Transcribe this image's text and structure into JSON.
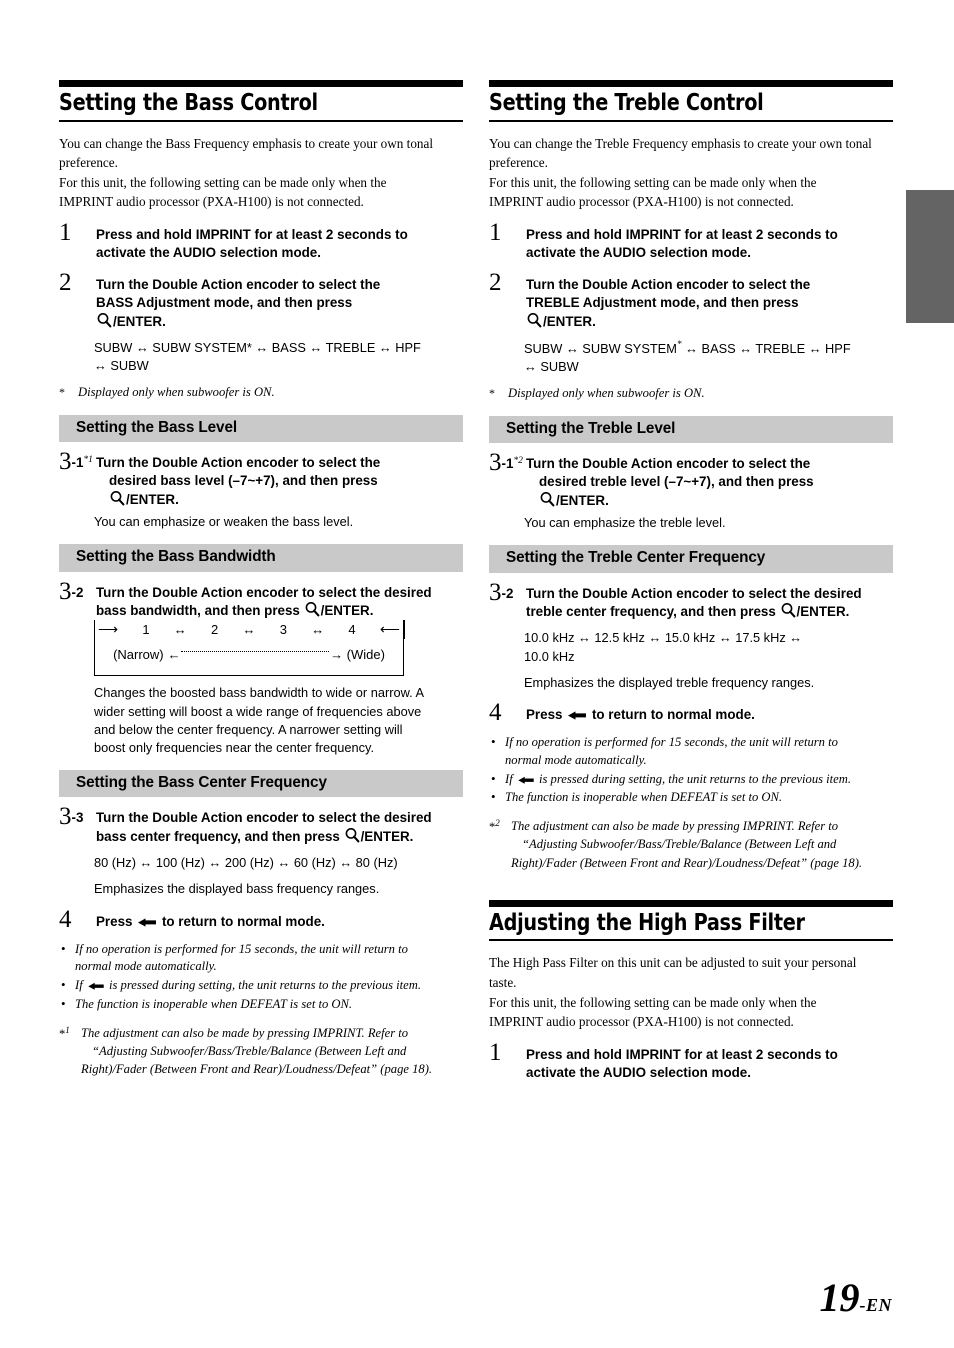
{
  "page": {
    "number": "19",
    "suffix": "-EN",
    "tab_marker_color": "#646464",
    "bar_color": "#c9c9c9"
  },
  "left_column": {
    "title": "Setting the Bass Control",
    "intro": [
      "You can change the Bass Frequency emphasis to create your own tonal",
      "preference.",
      "For this unit, the following setting can be made only when the",
      "IMPRINT audio processor (PXA-H100) is not connected."
    ],
    "step1": {
      "num": "1",
      "line1_a": "Press and hold ",
      "line1_b": "IMPRINT",
      "line1_c": " for at least 2 seconds to",
      "line2": "activate the AUDIO selection mode."
    },
    "step2": {
      "num": "2",
      "line1_a": "Turn the ",
      "line1_b": "Double Action encoder",
      "line1_c": " to select the",
      "line2": "BASS Adjustment mode, and then press",
      "line3": "/ENTER."
    },
    "sequence": {
      "line1": "SUBW ↔ SUBW SYSTEM* ↔ BASS ↔ TREBLE ↔ HPF",
      "line2": "↔ SUBW"
    },
    "note_asterisk": {
      "mark": "*",
      "text": "Displayed only when subwoofer is ON."
    },
    "bass_level": {
      "heading": "Setting the Bass Level",
      "num": "3",
      "sub": "-1",
      "footnote_mark": "*1",
      "line1_a": "Turn the ",
      "line1_b": "Double Action encoder",
      "line1_c": " to select the",
      "line2": "desired bass level (–7~+7), and then press",
      "line3": "/ENTER.",
      "desc": "You can emphasize or weaken the bass level."
    },
    "bass_bandwidth": {
      "heading": "Setting the Bass Bandwidth",
      "num": "3",
      "sub": "-2",
      "line1_a": "Turn the ",
      "line1_b": "Double Action encoder",
      "line1_c": " to select the",
      "line2_a": "desired bass bandwidth, and then press ",
      "line2_b": "/ENTER.",
      "diagram": {
        "left_arrow": "⟶",
        "right_arrow": "⟵",
        "values": [
          "1",
          "2",
          "3",
          "4"
        ],
        "separators": [
          "↔",
          "↔",
          "↔"
        ],
        "narrow_label": "(Narrow)",
        "wide_label": "(Wide)",
        "left_end_arrow": "←",
        "right_end_arrow": "→"
      },
      "desc": [
        "Changes the boosted bass bandwidth to wide or narrow. A",
        "wider setting will boost a wide range of frequencies above",
        "and below the center frequency. A narrower setting will",
        "boost only frequencies near the center frequency."
      ]
    },
    "bass_center_freq": {
      "heading": "Setting the Bass Center Frequency",
      "num": "3",
      "sub": "-3",
      "line1_a": "Turn the ",
      "line1_b": "Double Action encoder",
      "line1_c": " to select the",
      "line2": "desired bass center frequency, and then press",
      "line3": "/ENTER.",
      "values": "80 (Hz) ↔ 100 (Hz) ↔ 200 (Hz) ↔ 60 (Hz) ↔ 80 (Hz)",
      "desc": "Emphasizes the displayed bass frequency ranges."
    },
    "step4": {
      "num": "4",
      "text_a": "Press ",
      "text_b": " to return to normal mode."
    },
    "bullets": [
      [
        "If no operation is performed for 15 seconds, the unit will return to",
        "normal mode automatically."
      ],
      [
        "If ← is pressed during setting, the unit returns to the previous item."
      ],
      [
        "The function is inoperable when DEFEAT is set to ON."
      ]
    ],
    "footnote": {
      "mark": "*1",
      "lines": [
        "The adjustment can also be made by pressing IMPRINT. Refer to",
        "“Adjusting Subwoofer/Bass/Treble/Balance (Between Left and",
        "Right)/Fader (Between Front and Rear)/Loudness/Defeat” (page 18)."
      ]
    }
  },
  "right_column": {
    "title": "Setting the Treble Control",
    "intro": [
      "You can change the Treble Frequency emphasis to create your own tonal",
      "preference.",
      "For this unit, the following setting can be made only when the",
      "IMPRINT audio processor (PXA-H100) is not connected."
    ],
    "step1": {
      "num": "1",
      "line1_a": "Press and hold ",
      "line1_b": "IMPRINT",
      "line1_c": " for at least 2 seconds to",
      "line2": "activate the AUDIO selection mode."
    },
    "step2": {
      "num": "2",
      "line1_a": "Turn the ",
      "line1_b": "Double Action encoder",
      "line1_c": " to select the",
      "line2": "TREBLE Adjustment mode, and then press",
      "line3": "/ENTER."
    },
    "sequence": {
      "line1_a": "SUBW ↔ SUBW SYSTEM",
      "line1_sup": "*",
      "line1_b": " ↔ BASS ↔ TREBLE ↔ HPF",
      "line2": "↔ SUBW"
    },
    "note_asterisk": {
      "mark": "*",
      "text": "Displayed only when subwoofer is ON."
    },
    "treble_level": {
      "heading": "Setting the Treble Level",
      "num": "3",
      "sub": "-1",
      "footnote_mark": "*2",
      "line1_a": "Turn the ",
      "line1_b": "Double Action encoder",
      "line1_c": " to select the",
      "line2": "desired treble level (–7~+7), and then press",
      "line3": "/ENTER.",
      "desc": "You can emphasize the treble level."
    },
    "treble_center_freq": {
      "heading": "Setting the Treble Center Frequency",
      "num": "3",
      "sub": "-2",
      "line1_a": "Turn the ",
      "line1_b": "Double Action encoder",
      "line1_c": " to select the",
      "line2": "desired treble center frequency, and then press",
      "line3": "/ENTER.",
      "values_line1": "10.0 kHz ↔ 12.5 kHz ↔ 15.0 kHz ↔ 17.5 kHz ↔",
      "values_line2": "10.0 kHz",
      "desc": "Emphasizes the displayed treble frequency ranges."
    },
    "step4": {
      "num": "4",
      "text_a": "Press ",
      "text_b": " to return to normal mode."
    },
    "bullets": [
      [
        "If no operation is performed for 15 seconds, the unit will return to",
        "normal mode automatically."
      ],
      [
        "If ← is pressed during setting, the unit returns to the previous item."
      ],
      [
        "The function is inoperable when DEFEAT is set to ON."
      ]
    ],
    "footnote": {
      "mark": "*2",
      "lines": [
        "The adjustment can also be made by pressing IMPRINT. Refer to",
        "“Adjusting Subwoofer/Bass/Treble/Balance (Between Left and",
        "Right)/Fader (Between Front and Rear)/Loudness/Defeat” (page 18)."
      ]
    },
    "hpf": {
      "title": "Adjusting the High Pass Filter",
      "intro": [
        "The High Pass Filter on this unit can be adjusted to suit your personal",
        "taste.",
        "For this unit, the following setting can be made only when the",
        "IMPRINT audio processor (PXA-H100) is not connected."
      ],
      "step1": {
        "num": "1",
        "line1_a": "Press and hold ",
        "line1_b": "IMPRINT",
        "line1_c": " for at least 2 seconds to",
        "line2": "activate the AUDIO selection mode."
      }
    }
  },
  "icons": {
    "magnifier": "magnifier-icon",
    "return_arrow": "return-arrow-icon"
  }
}
